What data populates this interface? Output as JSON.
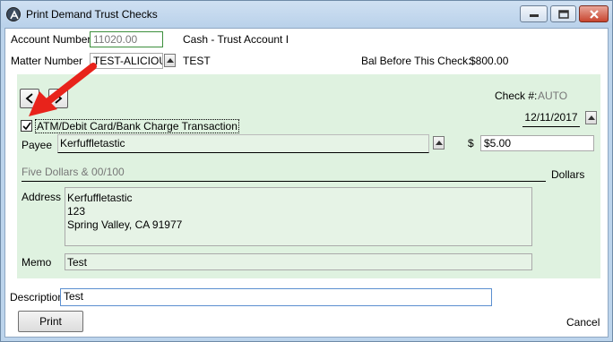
{
  "window": {
    "title": "Print Demand Trust Checks"
  },
  "header": {
    "account_number_label": "Account Number",
    "account_number_value": "11020.00",
    "account_name": "Cash - Trust Account I",
    "matter_number_label": "Matter Number",
    "matter_number_value": "TEST-ALICIOUS",
    "matter_name": "TEST",
    "balance_label": "Bal Before This Check:",
    "balance_value": "$800.00"
  },
  "check": {
    "check_number_label": "Check #:",
    "check_number_value": "AUTO",
    "atm_checkbox_label": "ATM/Debit Card/Bank Charge Transaction",
    "atm_checked": true,
    "date_value": "12/11/2017",
    "payee_label": "Payee",
    "payee_value": "Kerfuffletastic",
    "dollar_sign": "$",
    "amount_value": "$5.00",
    "amount_words": "Five Dollars & 00/100",
    "dollars_label": "Dollars",
    "address_label": "Address",
    "address_lines": [
      "Kerfuffletastic",
      "123",
      "Spring Valley, CA 91977"
    ],
    "memo_label": "Memo",
    "memo_value": "Test"
  },
  "footer": {
    "description_label": "Description",
    "description_value": "Test",
    "print_button_label": "Print",
    "cancel_button_label": "Cancel"
  },
  "annotation": {
    "arrow_color": "#e8231b"
  }
}
